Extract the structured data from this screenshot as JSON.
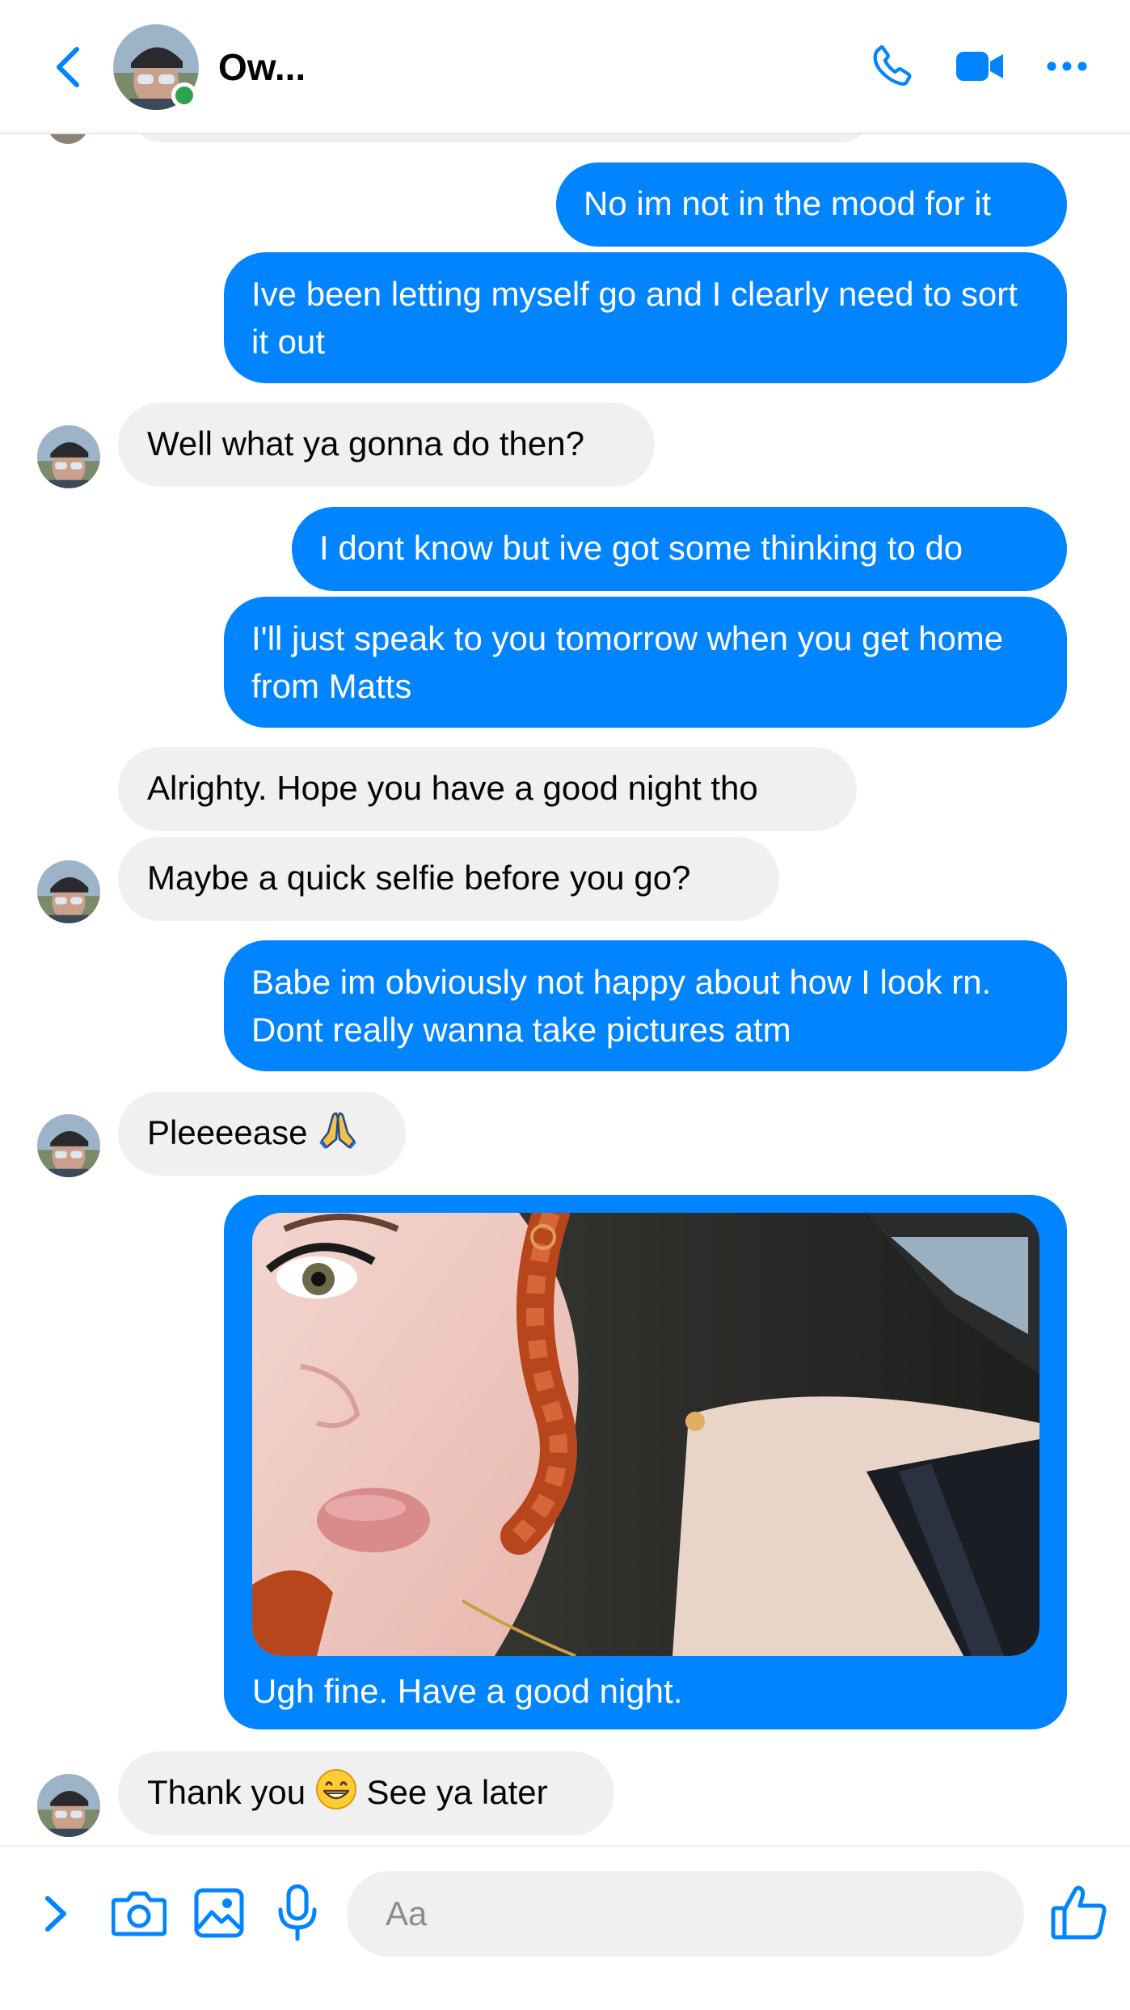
{
  "header": {
    "contact_name": "Ow...",
    "back_icon": "chevron-left-icon",
    "call_icon": "phone-icon",
    "video_icon": "video-camera-icon",
    "more_icon": "ellipsis-icon"
  },
  "messages": [
    {
      "side": "out",
      "text": "No im not in the mood for it"
    },
    {
      "side": "out",
      "text": "Ive been letting myself go and I clearly need to sort it out"
    },
    {
      "side": "in",
      "text": "Well what ya gonna do then?"
    },
    {
      "side": "out",
      "text": "I dont know but ive got some thinking to do"
    },
    {
      "side": "out",
      "text": "I'll just speak to you tomorrow when you get home from Matts"
    },
    {
      "side": "in",
      "text": "Alrighty. Hope you have a good night tho"
    },
    {
      "side": "in",
      "text": "Maybe a quick selfie before you go?"
    },
    {
      "side": "out",
      "text": "Babe im obviously not happy about how I look rn. Dont really wanna take pictures atm"
    },
    {
      "side": "in",
      "text": "Pleeeease",
      "emoji": "folded-hands-emoji"
    },
    {
      "side": "out",
      "type": "image",
      "caption": "Ugh fine. Have a good night."
    },
    {
      "side": "in",
      "text_before": "Thank you",
      "emoji": "grinning-face-emoji",
      "text_after": "See ya later"
    }
  ],
  "composer": {
    "placeholder": "Aa",
    "icons": [
      "chevron-right-icon",
      "camera-icon",
      "gallery-icon",
      "microphone-icon",
      "thumbs-up-icon"
    ]
  },
  "colors": {
    "accent": "#0084ff",
    "incoming_bubble": "#f0f0f0",
    "online": "#31a24c"
  }
}
